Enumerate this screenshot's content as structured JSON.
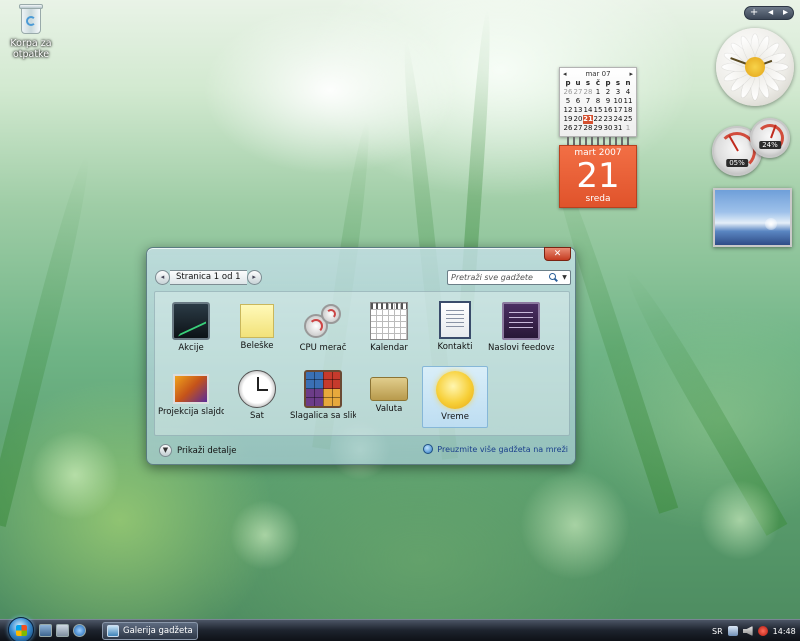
{
  "desktop": {
    "recycle_bin_label": "Korpa za otpatke"
  },
  "sidebar": {
    "controls": [
      "+",
      "◂",
      "▸"
    ],
    "cpu_readouts": [
      "05%",
      "24%"
    ]
  },
  "calendar": {
    "month_nav": {
      "prev": "◂",
      "title": "mar 07",
      "next": "▸"
    },
    "weekdays": [
      "p",
      "u",
      "s",
      "č",
      "p",
      "s",
      "n"
    ],
    "weeks": [
      [
        "26",
        "27",
        "28",
        "1",
        "2",
        "3",
        "4"
      ],
      [
        "5",
        "6",
        "7",
        "8",
        "9",
        "10",
        "11"
      ],
      [
        "12",
        "13",
        "14",
        "15",
        "16",
        "17",
        "18"
      ],
      [
        "19",
        "20",
        "21",
        "22",
        "23",
        "24",
        "25"
      ],
      [
        "26",
        "27",
        "28",
        "29",
        "30",
        "31",
        "1"
      ]
    ],
    "today": "21",
    "day_view": {
      "month_year": "mart 2007",
      "day": "21",
      "weekday": "sreda"
    }
  },
  "gallery": {
    "close_label": "✕",
    "pager": {
      "prev": "◂",
      "label": "Stranica 1 od 1",
      "next": "▸"
    },
    "search_placeholder": "Pretraži sve gadžete",
    "gadgets": [
      {
        "label": "Akcije",
        "icon": "stocks-icon",
        "thumb": "th-stocks"
      },
      {
        "label": "Beleške",
        "icon": "notes-icon",
        "thumb": "th-notes"
      },
      {
        "label": "CPU merač",
        "icon": "cpu-meter-icon",
        "thumb": "th-cpu"
      },
      {
        "label": "Kalendar",
        "icon": "calendar-icon",
        "thumb": "th-cal"
      },
      {
        "label": "Kontakti",
        "icon": "contacts-icon",
        "thumb": "th-contacts"
      },
      {
        "label": "Naslovi feedova",
        "icon": "feed-headlines-icon",
        "thumb": "th-feeds"
      },
      {
        "label": "Projekcija slajdo...",
        "icon": "slide-show-icon",
        "thumb": "th-slides"
      },
      {
        "label": "Sat",
        "icon": "clock-icon",
        "thumb": "th-clock"
      },
      {
        "label": "Slagalica sa slik...",
        "icon": "picture-puzzle-icon",
        "thumb": "th-puzzle"
      },
      {
        "label": "Valuta",
        "icon": "currency-icon",
        "thumb": "th-currency"
      },
      {
        "label": "Vreme",
        "icon": "weather-icon",
        "thumb": "th-weather",
        "selected": true
      }
    ],
    "show_details_label": "Prikaži detalje",
    "download_link_label": "Preuzmite više gadžeta na mreži"
  },
  "taskbar": {
    "window_button_label": "Galerija gadžeta",
    "language": "SR",
    "clock": "14:48"
  }
}
